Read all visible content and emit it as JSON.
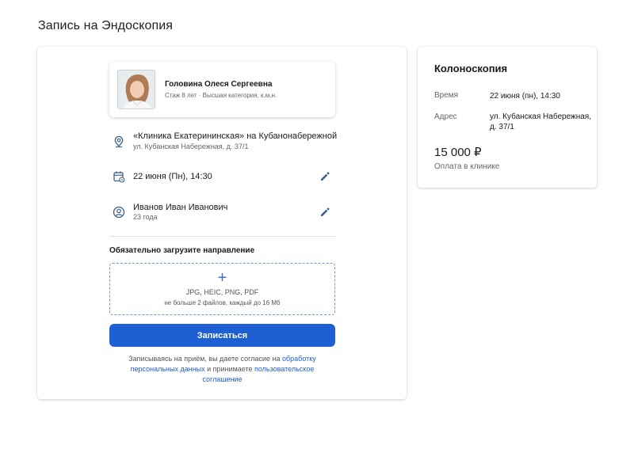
{
  "page": {
    "title": "Запись на Эндоскопия"
  },
  "doctor": {
    "name": "Головина Олеся Сергеевна",
    "meta": "Стаж 8 лет · Высшая категория, к.м.н."
  },
  "clinic": {
    "name": "«Клиника Екатерининская» на Кубанонабережной",
    "address": "ул. Кубанская Набережная, д. 37/1"
  },
  "appointment": {
    "datetime": "22 июня (Пн), 14:30"
  },
  "patient": {
    "name": "Иванов Иван Иванович",
    "age": "23 года"
  },
  "upload": {
    "title": "Обязательно загрузите направление",
    "plus": "+",
    "types": "JPG, HEIC, PNG, PDF",
    "limit": "не больше 2 файлов, каждый до 16 Мб"
  },
  "submit": {
    "label": "Записаться"
  },
  "consent": {
    "part1": "Записываясь на приём, вы даете согласие на ",
    "link1": "обработку персональных данных",
    "part2": " и принимаете ",
    "link2": "пользовательское соглашение"
  },
  "summary": {
    "service": "Колоноскопия",
    "time_label": "Время",
    "time_value": "22 июня (пн), 14:30",
    "address_label": "Адрес",
    "address_value": "ул. Кубанская Набережная, д. 37/1",
    "price": "15 000 ₽",
    "payment_note": "Оплата в клинике"
  },
  "colors": {
    "accent": "#1f5fd4",
    "icon": "#3a5f8a",
    "muted": "#666666"
  },
  "icons": {
    "clinic": "location-pin-icon",
    "date": "calendar-icon",
    "patient": "user-circle-icon",
    "edit": "pencil-icon",
    "upload": "plus-icon"
  }
}
